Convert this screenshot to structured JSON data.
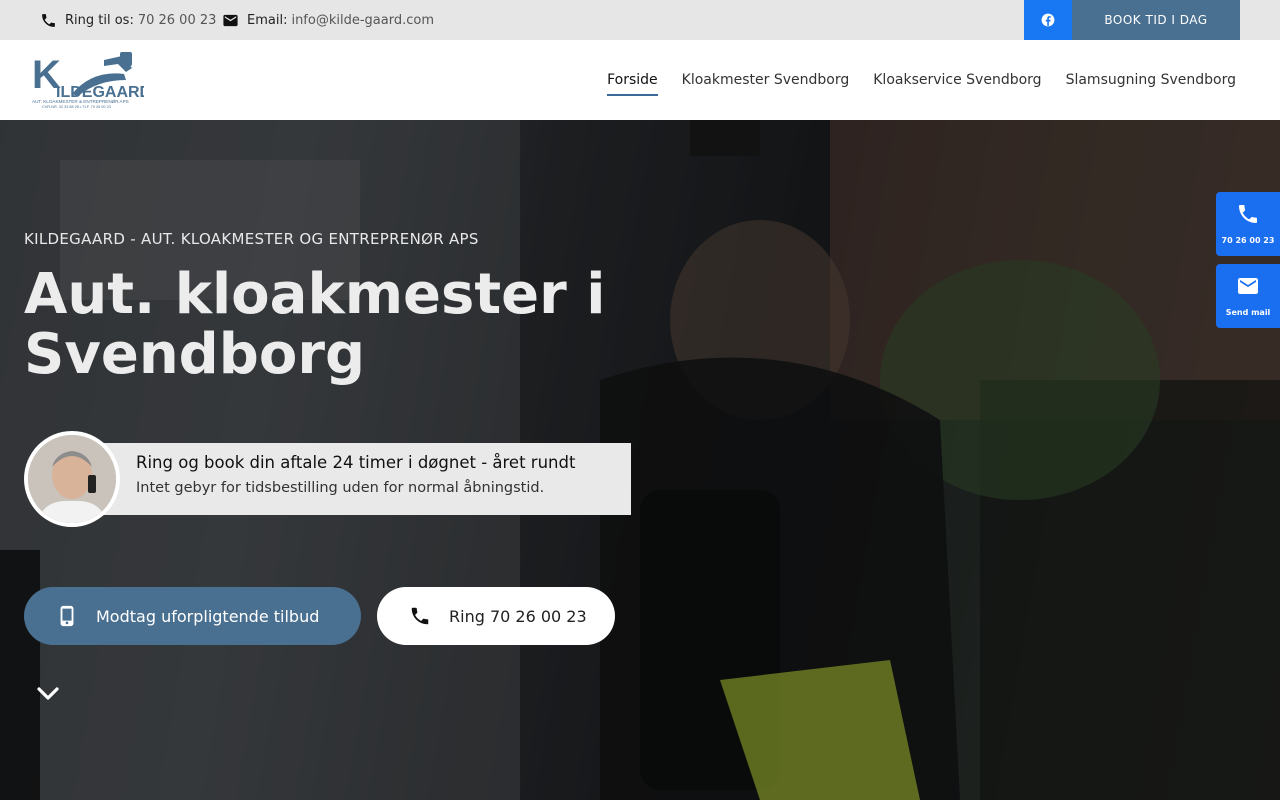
{
  "topbar": {
    "phone_label": "Ring til os:",
    "phone_value": "70 26 00 23",
    "email_label": "Email:",
    "email_value": "info@kilde-gaard.com",
    "book_label": "BOOK TID I DAG"
  },
  "logo": {
    "name": "ILDEGAARD",
    "initial": "K",
    "tagline": "AUT. KLOAKMESTER & ENTREPRENØR APS",
    "subline": "CVR-NR. 32 33 88 28 • TLF. 70 26 00 23"
  },
  "nav": {
    "items": [
      {
        "label": "Forside"
      },
      {
        "label": "Kloakmester Svendborg"
      },
      {
        "label": "Kloakservice Svendborg"
      },
      {
        "label": "Slamsugning Svendborg"
      }
    ]
  },
  "hero": {
    "eyebrow": "KILDEGAARD - AUT. KLOAKMESTER OG ENTREPRENØR APS",
    "title": "Aut. kloakmester i Svendborg",
    "info_line1": "Ring og book din aftale 24 timer i døgnet - året rundt",
    "info_line2": "Intet gebyr for tidsbestilling uden for normal åbningstid.",
    "offer_button": "Modtag uforpligtende tilbud",
    "call_button": "Ring 70 26 00 23"
  },
  "side": {
    "call_label": "70 26 00 23",
    "mail_label": "Send mail"
  },
  "colors": {
    "accent": "#4a7091",
    "facebook": "#1877f2",
    "side_button": "#1a6ef0",
    "topbar_bg": "#e6e6e6"
  }
}
